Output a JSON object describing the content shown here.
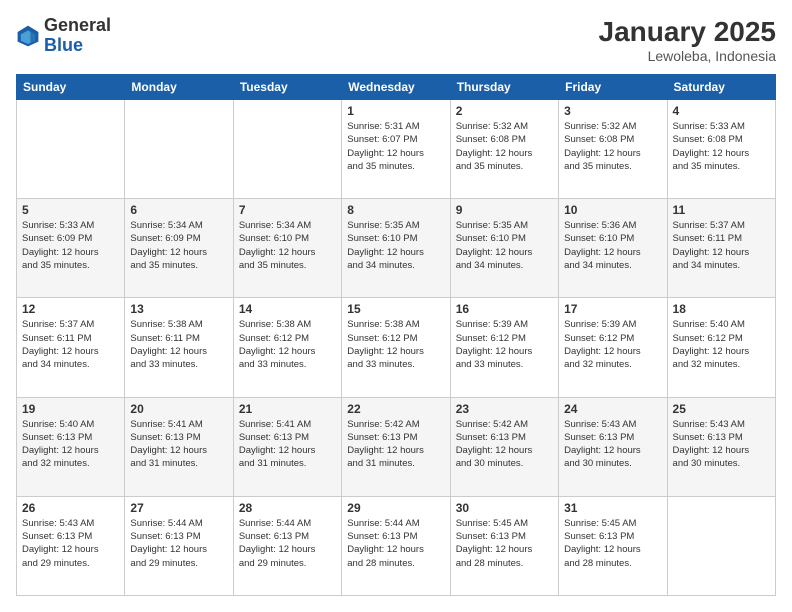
{
  "header": {
    "logo": {
      "general": "General",
      "blue": "Blue"
    },
    "title": "January 2025",
    "location": "Lewoleba, Indonesia"
  },
  "calendar": {
    "weekdays": [
      "Sunday",
      "Monday",
      "Tuesday",
      "Wednesday",
      "Thursday",
      "Friday",
      "Saturday"
    ],
    "weeks": [
      [
        {
          "day": "",
          "info": ""
        },
        {
          "day": "",
          "info": ""
        },
        {
          "day": "",
          "info": ""
        },
        {
          "day": "1",
          "info": "Sunrise: 5:31 AM\nSunset: 6:07 PM\nDaylight: 12 hours\nand 35 minutes."
        },
        {
          "day": "2",
          "info": "Sunrise: 5:32 AM\nSunset: 6:08 PM\nDaylight: 12 hours\nand 35 minutes."
        },
        {
          "day": "3",
          "info": "Sunrise: 5:32 AM\nSunset: 6:08 PM\nDaylight: 12 hours\nand 35 minutes."
        },
        {
          "day": "4",
          "info": "Sunrise: 5:33 AM\nSunset: 6:08 PM\nDaylight: 12 hours\nand 35 minutes."
        }
      ],
      [
        {
          "day": "5",
          "info": "Sunrise: 5:33 AM\nSunset: 6:09 PM\nDaylight: 12 hours\nand 35 minutes."
        },
        {
          "day": "6",
          "info": "Sunrise: 5:34 AM\nSunset: 6:09 PM\nDaylight: 12 hours\nand 35 minutes."
        },
        {
          "day": "7",
          "info": "Sunrise: 5:34 AM\nSunset: 6:10 PM\nDaylight: 12 hours\nand 35 minutes."
        },
        {
          "day": "8",
          "info": "Sunrise: 5:35 AM\nSunset: 6:10 PM\nDaylight: 12 hours\nand 34 minutes."
        },
        {
          "day": "9",
          "info": "Sunrise: 5:35 AM\nSunset: 6:10 PM\nDaylight: 12 hours\nand 34 minutes."
        },
        {
          "day": "10",
          "info": "Sunrise: 5:36 AM\nSunset: 6:10 PM\nDaylight: 12 hours\nand 34 minutes."
        },
        {
          "day": "11",
          "info": "Sunrise: 5:37 AM\nSunset: 6:11 PM\nDaylight: 12 hours\nand 34 minutes."
        }
      ],
      [
        {
          "day": "12",
          "info": "Sunrise: 5:37 AM\nSunset: 6:11 PM\nDaylight: 12 hours\nand 34 minutes."
        },
        {
          "day": "13",
          "info": "Sunrise: 5:38 AM\nSunset: 6:11 PM\nDaylight: 12 hours\nand 33 minutes."
        },
        {
          "day": "14",
          "info": "Sunrise: 5:38 AM\nSunset: 6:12 PM\nDaylight: 12 hours\nand 33 minutes."
        },
        {
          "day": "15",
          "info": "Sunrise: 5:38 AM\nSunset: 6:12 PM\nDaylight: 12 hours\nand 33 minutes."
        },
        {
          "day": "16",
          "info": "Sunrise: 5:39 AM\nSunset: 6:12 PM\nDaylight: 12 hours\nand 33 minutes."
        },
        {
          "day": "17",
          "info": "Sunrise: 5:39 AM\nSunset: 6:12 PM\nDaylight: 12 hours\nand 32 minutes."
        },
        {
          "day": "18",
          "info": "Sunrise: 5:40 AM\nSunset: 6:12 PM\nDaylight: 12 hours\nand 32 minutes."
        }
      ],
      [
        {
          "day": "19",
          "info": "Sunrise: 5:40 AM\nSunset: 6:13 PM\nDaylight: 12 hours\nand 32 minutes."
        },
        {
          "day": "20",
          "info": "Sunrise: 5:41 AM\nSunset: 6:13 PM\nDaylight: 12 hours\nand 31 minutes."
        },
        {
          "day": "21",
          "info": "Sunrise: 5:41 AM\nSunset: 6:13 PM\nDaylight: 12 hours\nand 31 minutes."
        },
        {
          "day": "22",
          "info": "Sunrise: 5:42 AM\nSunset: 6:13 PM\nDaylight: 12 hours\nand 31 minutes."
        },
        {
          "day": "23",
          "info": "Sunrise: 5:42 AM\nSunset: 6:13 PM\nDaylight: 12 hours\nand 30 minutes."
        },
        {
          "day": "24",
          "info": "Sunrise: 5:43 AM\nSunset: 6:13 PM\nDaylight: 12 hours\nand 30 minutes."
        },
        {
          "day": "25",
          "info": "Sunrise: 5:43 AM\nSunset: 6:13 PM\nDaylight: 12 hours\nand 30 minutes."
        }
      ],
      [
        {
          "day": "26",
          "info": "Sunrise: 5:43 AM\nSunset: 6:13 PM\nDaylight: 12 hours\nand 29 minutes."
        },
        {
          "day": "27",
          "info": "Sunrise: 5:44 AM\nSunset: 6:13 PM\nDaylight: 12 hours\nand 29 minutes."
        },
        {
          "day": "28",
          "info": "Sunrise: 5:44 AM\nSunset: 6:13 PM\nDaylight: 12 hours\nand 29 minutes."
        },
        {
          "day": "29",
          "info": "Sunrise: 5:44 AM\nSunset: 6:13 PM\nDaylight: 12 hours\nand 28 minutes."
        },
        {
          "day": "30",
          "info": "Sunrise: 5:45 AM\nSunset: 6:13 PM\nDaylight: 12 hours\nand 28 minutes."
        },
        {
          "day": "31",
          "info": "Sunrise: 5:45 AM\nSunset: 6:13 PM\nDaylight: 12 hours\nand 28 minutes."
        },
        {
          "day": "",
          "info": ""
        }
      ]
    ]
  }
}
